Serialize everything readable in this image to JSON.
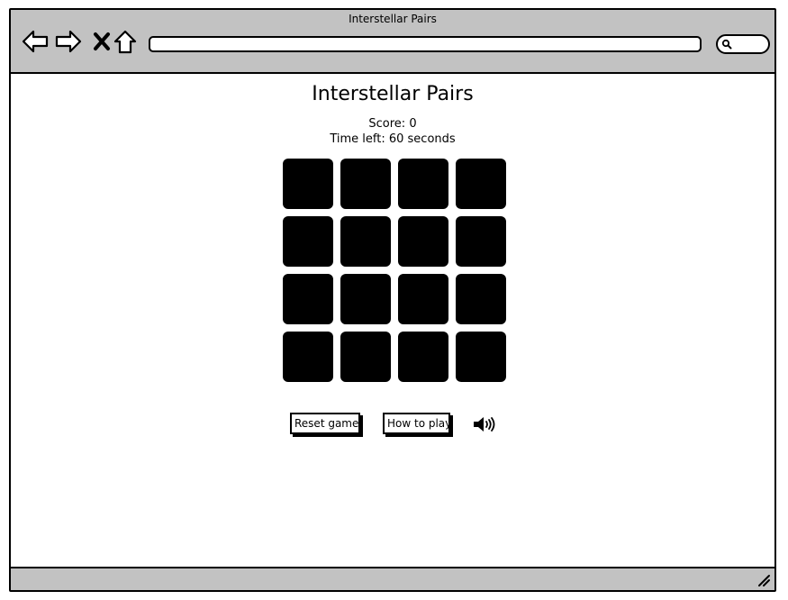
{
  "window": {
    "title": "Interstellar Pairs"
  },
  "browser": {
    "url": "",
    "search_placeholder": ""
  },
  "icons": {
    "back": "arrow-left-icon",
    "forward": "arrow-right-icon",
    "stop": "close-icon",
    "home": "home-icon",
    "search": "search-icon",
    "sound": "speaker-icon",
    "resize": "resize-grip-icon"
  },
  "game": {
    "title": "Interstellar Pairs",
    "score_label": "Score:",
    "score_value": "0",
    "time_label": "Time left:",
    "time_value": "60",
    "time_unit": "seconds",
    "cards": [
      {
        "state": "face-down"
      },
      {
        "state": "face-down"
      },
      {
        "state": "face-down"
      },
      {
        "state": "face-down"
      },
      {
        "state": "face-down"
      },
      {
        "state": "face-down"
      },
      {
        "state": "face-down"
      },
      {
        "state": "face-down"
      },
      {
        "state": "face-down"
      },
      {
        "state": "face-down"
      },
      {
        "state": "face-down"
      },
      {
        "state": "face-down"
      },
      {
        "state": "face-down"
      },
      {
        "state": "face-down"
      },
      {
        "state": "face-down"
      },
      {
        "state": "face-down"
      }
    ]
  },
  "controls": {
    "reset_label": "Reset game",
    "help_label": "How to play"
  },
  "colors": {
    "chrome": "#c2c2c2",
    "card_back": "#000000",
    "background": "#ffffff"
  }
}
